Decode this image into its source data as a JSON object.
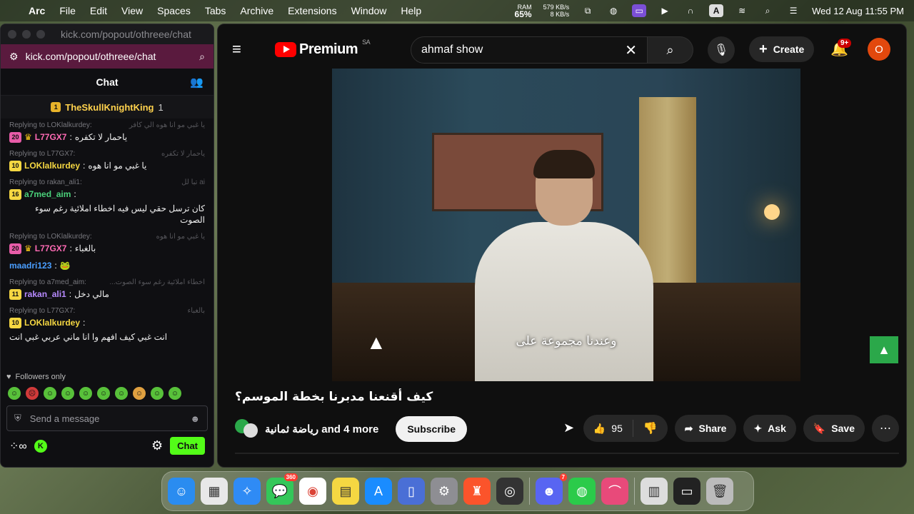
{
  "menubar": {
    "app_name": "Arc",
    "items": [
      "File",
      "Edit",
      "View",
      "Spaces",
      "Tabs",
      "Archive",
      "Extensions",
      "Window",
      "Help"
    ],
    "ram_label": "RAM",
    "ram_value": "65%",
    "net_up": "579 KB/s",
    "net_down": "8 KB/s",
    "input_letter": "A",
    "datetime": "Wed 12 Aug  11:55 PM"
  },
  "chat_window": {
    "titlebar_url": "kick.com/popout/othreee/chat",
    "url": "kick.com/popout/othreee/chat",
    "header": "Chat",
    "pinned": {
      "user": "TheSkullKnightKing",
      "count": "1"
    },
    "messages": [
      {
        "reply": "Replying to LOKlalkurdey:",
        "reply_quote": "يا غبي مو انا هوه الي كافر",
        "badge": "20",
        "badge_color": "#e85ca8",
        "crown": true,
        "user": "L77GX7",
        "user_color": "#ff6bb5",
        "text": "ياحمار لا تكفره"
      },
      {
        "reply": "Replying to L77GX7:",
        "reply_quote": "ياحمار لا تكفره",
        "badge": "10",
        "badge_color": "#f5d742",
        "crown": false,
        "user": "LOKlalkurdey",
        "user_color": "#f5d742",
        "text": "يا غبي مو انا هوه"
      },
      {
        "reply": "Replying to rakan_ali1:",
        "reply_quote": "ai تبا لل",
        "badge": "16",
        "badge_color": "#f5d742",
        "crown": false,
        "user": "a7med_aim",
        "user_color": "#4ad17a",
        "text": "كان ترسل حقي ليس فيه اخطاء املائية رغم سوء الصوت"
      },
      {
        "reply": "Replying to LOKlalkurdey:",
        "reply_quote": "يا غبي مو انا هوه",
        "badge": "20",
        "badge_color": "#e85ca8",
        "crown": true,
        "user": "L77GX7",
        "user_color": "#ff6bb5",
        "text": "بالغباء"
      },
      {
        "reply": "",
        "reply_quote": "",
        "badge": "",
        "badge_color": "",
        "crown": false,
        "user": "maadri123",
        "user_color": "#4a9eff",
        "text": "🐸"
      },
      {
        "reply": "Replying to a7med_aim:",
        "reply_quote": "اخطاء املائية رغم سوء الصوت...",
        "badge": "11",
        "badge_color": "#f5d742",
        "crown": false,
        "user": "rakan_ali1",
        "user_color": "#b78aff",
        "text": "مالي دخل"
      },
      {
        "reply": "Replying to L77GX7:",
        "reply_quote": "بالغباء",
        "badge": "10",
        "badge_color": "#f5d742",
        "crown": false,
        "user": "LOKlalkurdey",
        "user_color": "#f5d742",
        "text": "انت غبي كيف افهم وا انا ماني عربي غبي انت"
      }
    ],
    "followers_only": "Followers only",
    "input_placeholder": "Send a message",
    "chat_button": "Chat",
    "k_badge": "K"
  },
  "youtube": {
    "logo_text": "Premium",
    "region": "SA",
    "search_value": "ahmaf show",
    "create_label": "Create",
    "notif_count": "9+",
    "avatar_letter": "O",
    "subtitle": "وعندنا مجموعة على",
    "video_title": "كيف أقنعنا مدبرنا بخطة الموسم؟",
    "channel_name": "رياضة ثمانية and 4 more",
    "subscribe": "Subscribe",
    "likes": "95",
    "share": "Share",
    "ask": "Ask",
    "save": "Save"
  },
  "dock": {
    "messages_badge": "360",
    "discord_badge": "7"
  },
  "colors": {
    "kick_green": "#53fc18",
    "yt_red": "#ff0000",
    "url_bar": "#5a1a3e"
  }
}
